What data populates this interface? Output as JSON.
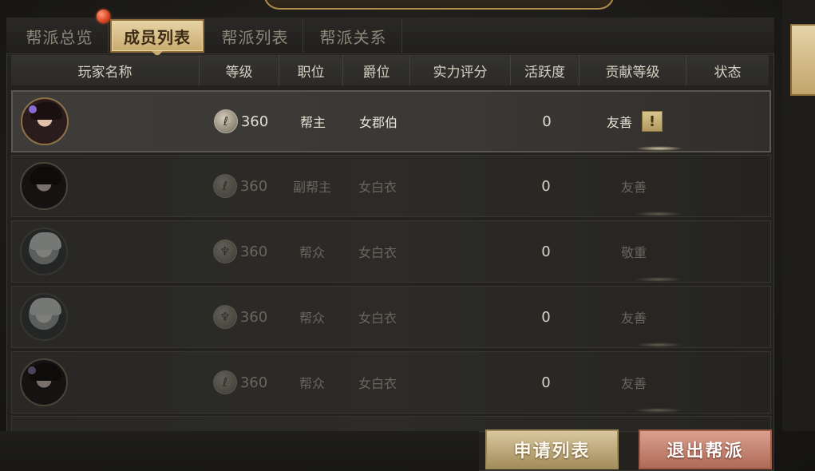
{
  "tabs": [
    {
      "label": "帮派总览"
    },
    {
      "label": "成员列表"
    },
    {
      "label": "帮派列表"
    },
    {
      "label": "帮派关系"
    }
  ],
  "columns": [
    "玩家名称",
    "等级",
    "职位",
    "爵位",
    "实力评分",
    "活跃度",
    "贡献等级",
    "状态"
  ],
  "members": [
    {
      "level": "360",
      "position": "帮主",
      "title": "女郡伯",
      "power": "",
      "activity": "0",
      "contribution": "友善",
      "status": "!"
    },
    {
      "level": "360",
      "position": "副帮主",
      "title": "女白衣",
      "power": "",
      "activity": "0",
      "contribution": "友善",
      "status": ""
    },
    {
      "level": "360",
      "position": "帮众",
      "title": "女白衣",
      "power": "",
      "activity": "0",
      "contribution": "敬重",
      "status": ""
    },
    {
      "level": "360",
      "position": "帮众",
      "title": "女白衣",
      "power": "",
      "activity": "0",
      "contribution": "友善",
      "status": ""
    },
    {
      "level": "360",
      "position": "帮众",
      "title": "女白衣",
      "power": "",
      "activity": "0",
      "contribution": "友善",
      "status": ""
    }
  ],
  "buttons": {
    "apply_list": "申请列表",
    "quit_guild": "退出帮派"
  },
  "colors": {
    "tab_active": "#c9ab70",
    "apply_button": "#a48d5c",
    "quit_button": "#b06b58"
  }
}
